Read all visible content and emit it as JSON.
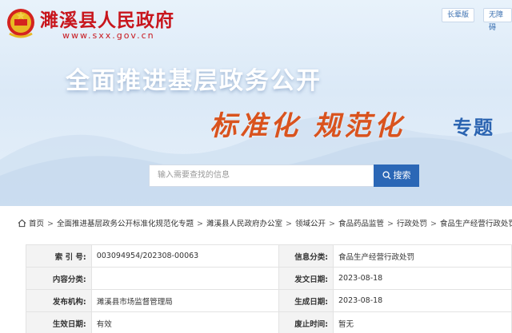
{
  "header": {
    "site_name": "濉溪县人民政府",
    "site_url": "www.sxx.gov.cn",
    "elder_button": "长辈版",
    "accessibility_button": "无障碍"
  },
  "banner": {
    "headline": "全面推进基层政务公开",
    "subheadline": "标准化 规范化",
    "subheadline_suffix": "专题"
  },
  "search": {
    "placeholder": "输入需要查找的信息",
    "button_label": "搜索"
  },
  "breadcrumb": [
    "首页",
    "全面推进基层政务公开标准化规范化专题",
    "濉溪县人民政府办公室",
    "领域公开",
    "食品药品监管",
    "行政处罚",
    "食品生产经营行政处罚"
  ],
  "info": {
    "index_label": "索 引 号:",
    "index_value": "003094954/202308-00063",
    "category_label": "信息分类:",
    "category_value": "食品生产经营行政处罚",
    "content_label": "内容分类:",
    "content_value": "",
    "date_label": "发文日期:",
    "date_value": "2023-08-18",
    "org_label": "发布机构:",
    "org_value": "濉溪县市场监督管理局",
    "gen_date_label": "生成日期:",
    "gen_date_value": "2023-08-18",
    "status_label": "生效日期:",
    "status_value": "有效",
    "expire_label": "废止时间:",
    "expire_value": "暂无"
  },
  "colors": {
    "brand_red": "#c8161d",
    "accent_blue": "#2b67b6",
    "orange": "#d9531e"
  }
}
